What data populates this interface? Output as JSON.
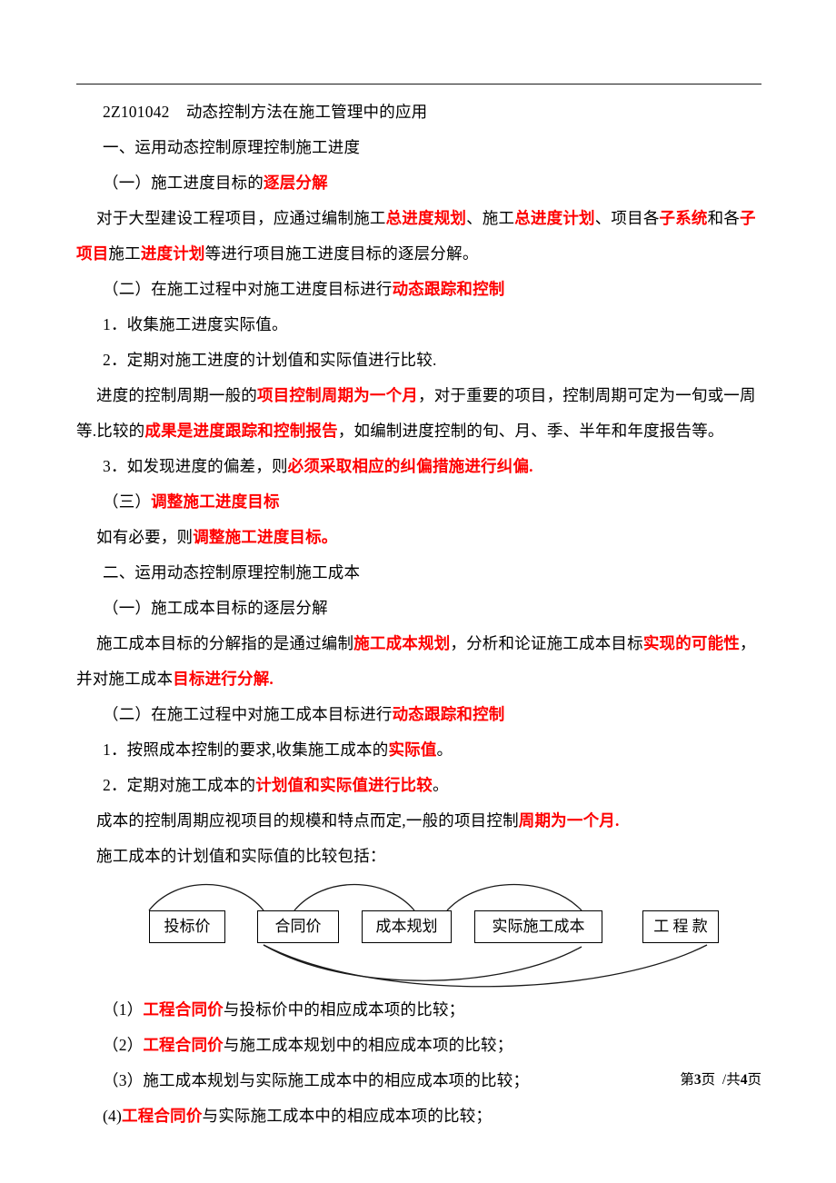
{
  "document": {
    "section_code": "2Z101042",
    "section_title": "动态控制方法在施工管理中的应用",
    "heading_1": "一、运用动态控制原理控制施工进度",
    "heading_2": "二、运用动态控制原理控制施工成本"
  },
  "part1": {
    "sub_a_plain": "（一）施工进度目标的",
    "sub_a_hl": "逐层分解",
    "para1_a": "对于大型建设工程项目，应通过编制施工",
    "para1_hl1": "总进度规划",
    "para1_b": "、施工",
    "para1_hl2": "总进度计划",
    "para1_c": "、项目各",
    "para1_hl3": "子系统",
    "para1_d": "和各",
    "para1_hl4": "子项",
    "para2_hl1": "目",
    "para2_a": "施工",
    "para2_hl2": "进度计划",
    "para2_b": "等进行项目施工进度目标的逐层分解。",
    "sub_b_plain": "（二）在施工过程中对施工进度目标进行",
    "sub_b_hl": "动态跟踪和控制",
    "item1": "1．收集施工进度实际值。",
    "item2": "2．定期对施工进度的计划值和实际值进行比较.",
    "para3_a": "进度的控制周期一般的",
    "para3_hl": "项目控制周期为一个月",
    "para3_b": "，对于重要的项目，控制周期可定为一旬或一周等.",
    "para4_a": "比较的",
    "para4_hl": "成果是进度跟踪和控制报告",
    "para4_b": "，如编制进度控制的旬、月、季、半年和年度报告等。",
    "item3_a": "3．如发现进度的偏差，则",
    "item3_hl": "必须采取相应的纠偏措施进行纠偏.",
    "sub_c_plain": "（三）",
    "sub_c_hl": "调整施工进度目标",
    "para5_a": "如有必要，则",
    "para5_hl": "调整施工进度目标。"
  },
  "part2": {
    "sub_a": "（一）施工成本目标的逐层分解",
    "para1_a": "施工成本目标的分解指的是通过编制",
    "para1_hl1": "施工成本规划",
    "para1_b": "，分析和论证施工成本目标",
    "para1_hl2": "实现的可能性",
    "para1_c": "，并",
    "para2_a": "对施工成本",
    "para2_hl": "目标进行分解.",
    "sub_b_plain": "（二）在施工过程中对施工成本目标进行",
    "sub_b_hl": "动态跟踪和控制",
    "item1_a": "1．按照成本控制的要求,收集施工成本的",
    "item1_hl": "实际值",
    "item1_b": "。",
    "item2_a": "2．定期对施工成本的",
    "item2_hl": "计划值和实际值进行比较",
    "item2_b": "。",
    "para3_a": "成本的控制周期应视项目的规模和特点而定,一般的项目控制",
    "para3_hl": "周期为一个月.",
    "para4": "施工成本的计划值和实际值的比较包括："
  },
  "diagram": {
    "boxes": [
      {
        "label": "投标价"
      },
      {
        "label": "合同价"
      },
      {
        "label": "成本规划"
      },
      {
        "label": "实际施工成本"
      },
      {
        "label": "工 程 款"
      }
    ],
    "line_color": "#1a1a1a"
  },
  "comparison_list": [
    {
      "prefix": "（1）",
      "hl": "工程合同价",
      "rest": "与投标价中的相应成本项的比较；"
    },
    {
      "prefix": "（2）",
      "hl": "工程合同价",
      "rest": "与施工成本规划中的相应成本项的比较；"
    },
    {
      "prefix": "（3）",
      "hl": "",
      "rest": "施工成本规划与实际施工成本中的相应成本项的比较；"
    },
    {
      "prefix": "(4)",
      "hl": "工程合同价",
      "rest": "与实际施工成本中的相应成本项的比较；"
    }
  ],
  "footer": {
    "pre": "第",
    "current_page": "3",
    "mid": "页  /共",
    "total_pages": "4",
    "post": "页"
  },
  "colors": {
    "highlight": "#ff0000",
    "text": "#000000",
    "rule": "#1a1a1a"
  }
}
